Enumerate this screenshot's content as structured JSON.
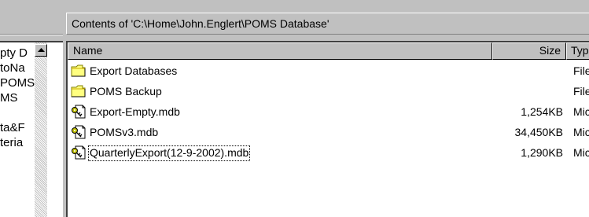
{
  "tree": {
    "items": [
      "pty D",
      "toNa",
      "POMS",
      "MS",
      "",
      "ta&F",
      "teria"
    ]
  },
  "contents": {
    "title": "Contents of 'C:\\Home\\John.Englert\\POMS Database'"
  },
  "columns": {
    "name": "Name",
    "size": "Size",
    "type": "Typ"
  },
  "files": [
    {
      "name": "Export Databases",
      "size": "",
      "type": "File",
      "icon": "folder-icon"
    },
    {
      "name": "POMS Backup",
      "size": "",
      "type": "File",
      "icon": "folder-icon"
    },
    {
      "name": "Export-Empty.mdb",
      "size": "1,254KB",
      "type": "Mic",
      "icon": "access-db-icon"
    },
    {
      "name": "POMSv3.mdb",
      "size": "34,450KB",
      "type": "Mic",
      "icon": "access-db-icon"
    },
    {
      "name": "QuarterlyExport(12-9-2002).mdb",
      "size": "1,290KB",
      "type": "Mic",
      "icon": "access-db-icon",
      "focused": true
    }
  ],
  "colors": {
    "folder": "#ffff80",
    "folder_dark": "#c8a800",
    "key": "#c0c000"
  }
}
